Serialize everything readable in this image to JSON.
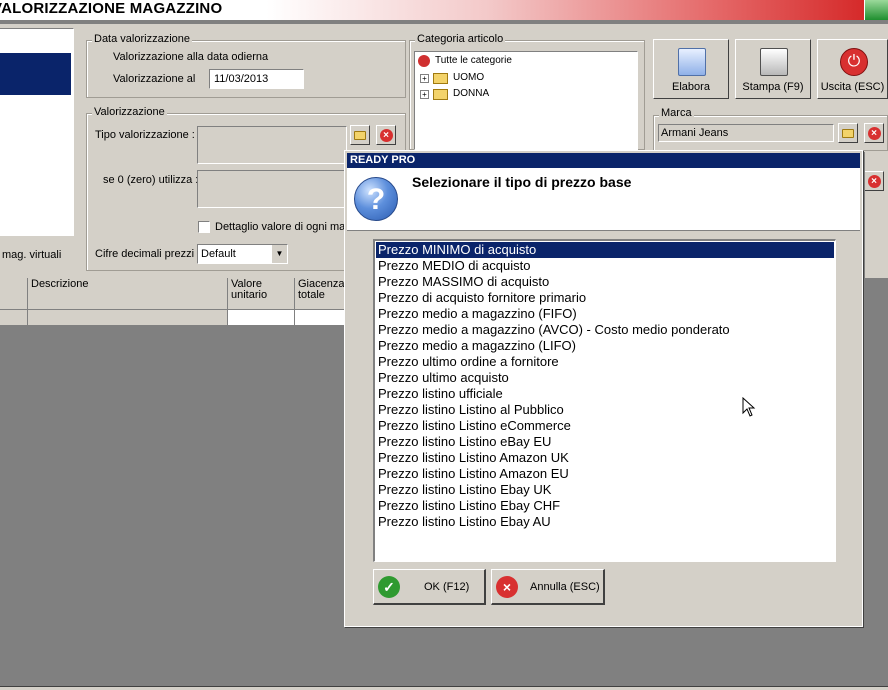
{
  "window": {
    "title": "VALORIZZAZIONE MAGAZZINO"
  },
  "left_panel": {
    "virtual_label": "mag. virtuali"
  },
  "data_val": {
    "legend": "Data valorizzazione",
    "radio_today": "Valorizzazione alla data odierna",
    "radio_at": "Valorizzazione al",
    "date_value": "11/03/2013"
  },
  "valorizzazione": {
    "legend": "Valorizzazione",
    "tipo_label": "Tipo valorizzazione :",
    "zero_label": "se 0 (zero) utilizza :",
    "dettaglio_label": "Dettaglio valore di ogni mag",
    "decimali_label": "Cifre decimali prezzi :",
    "decimali_value": "Default"
  },
  "categoria": {
    "legend": "Categoria articolo",
    "root": "Tutte le categorie",
    "children": [
      "UOMO",
      "DONNA"
    ]
  },
  "toolbar": {
    "elabora": "Elabora",
    "stampa": "Stampa (F9)",
    "uscita": "Uscita (ESC)"
  },
  "marca": {
    "legend": "Marca",
    "value": "Armani Jeans"
  },
  "grid": {
    "columns": [
      "Descrizione",
      "Valore unitario",
      "Giacenza totale"
    ]
  },
  "dialog": {
    "title": "READY PRO",
    "prompt": "Selezionare il tipo di prezzo base",
    "options": [
      "Prezzo MINIMO di acquisto",
      "Prezzo MEDIO di acquisto",
      "Prezzo MASSIMO di acquisto",
      "Prezzo di acquisto fornitore primario",
      "Prezzo medio a magazzino (FIFO)",
      "Prezzo medio a magazzino (AVCO) - Costo medio ponderato",
      "Prezzo medio a magazzino (LIFO)",
      "Prezzo ultimo ordine a fornitore",
      "Prezzo ultimo acquisto",
      "Prezzo listino ufficiale",
      "Prezzo listino Listino al Pubblico",
      "Prezzo listino Listino eCommerce",
      "Prezzo listino Listino eBay EU",
      "Prezzo listino Listino Amazon UK",
      "Prezzo listino Listino Amazon EU",
      "Prezzo listino Listino Ebay UK",
      "Prezzo listino Listino Ebay CHF",
      "Prezzo listino Listino Ebay AU"
    ],
    "selected_index": 0,
    "ok_label": "OK (F12)",
    "cancel_label": "Annulla (ESC)"
  },
  "colors": {
    "selection": "#0a246a",
    "face": "#d4d0c8",
    "desktop": "#808080"
  }
}
